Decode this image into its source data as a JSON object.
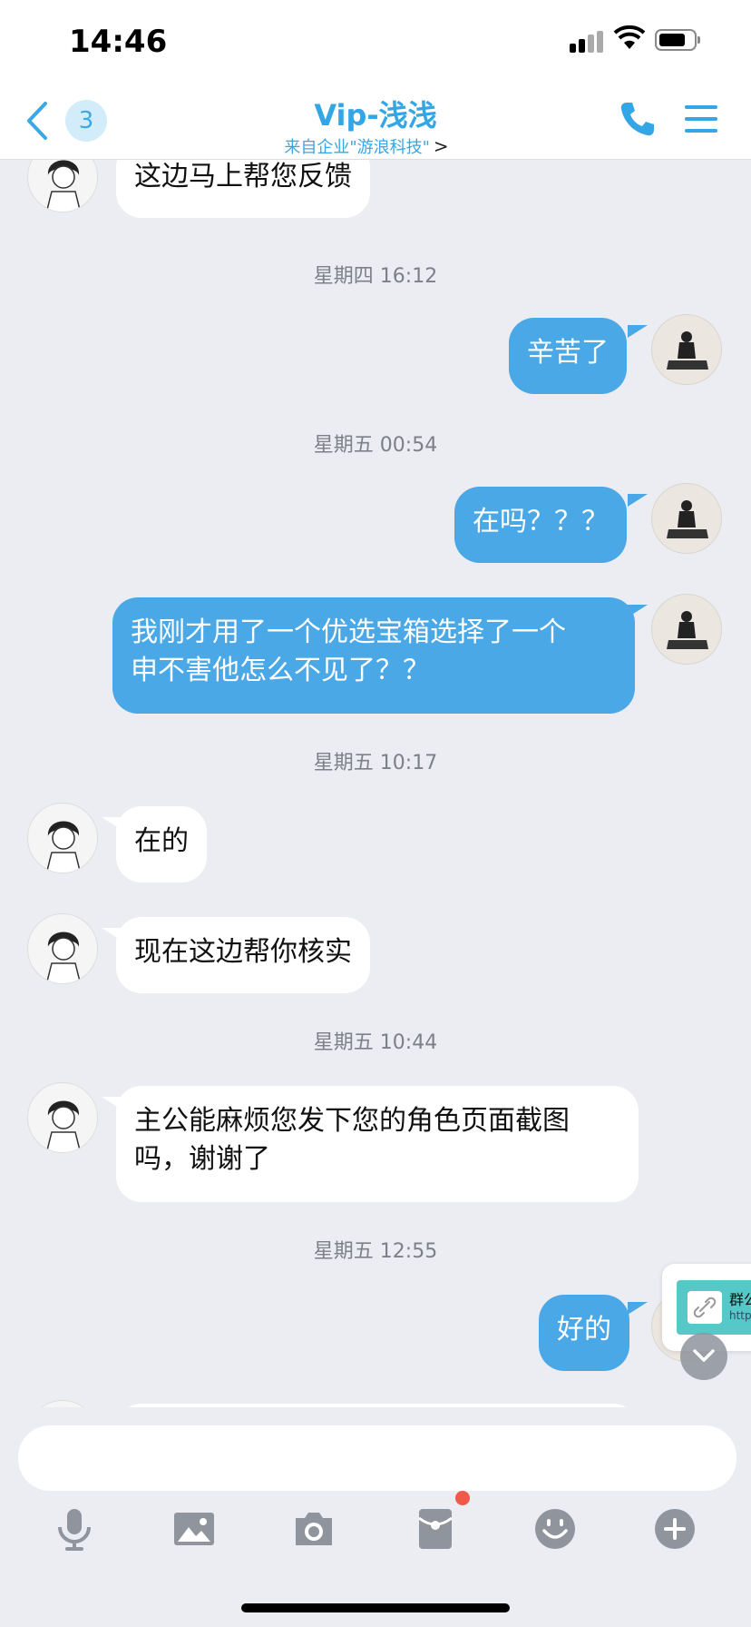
{
  "status_bar": {
    "time": "14:46"
  },
  "header": {
    "unread_count": "3",
    "title": "Vip-浅浅",
    "subtitle": "来自企业\"游浪科技\"",
    "subtitle_chevron": ">"
  },
  "messages": {
    "m0": "这边马上帮您反馈",
    "t1": "星期四 16:12",
    "m1": "辛苦了",
    "t2": "星期五 00:54",
    "m2": "在吗？？？",
    "m3_line1": "我刚才用了一个优选宝箱选择了一个",
    "m3_line2": "申不害他怎么不见了？？",
    "t3": "星期五 10:17",
    "m4": "在的",
    "m5": "现在这边帮你核实",
    "t4": "星期五 10:44",
    "m6_line1": "主公能麻烦您发下您的角色页面截图",
    "m6_line2": "吗，谢谢了",
    "t5": "星期五 12:55",
    "m7": "好的"
  },
  "floating_card": {
    "text": "群公",
    "url": "http"
  },
  "colors": {
    "accent": "#34a5e5",
    "out_bubble": "#4aa8e6",
    "background": "#ebedf3"
  },
  "toolbar": {
    "icons": [
      "microphone-icon",
      "image-icon",
      "camera-icon",
      "red-packet-icon",
      "emoji-icon",
      "plus-icon"
    ]
  }
}
